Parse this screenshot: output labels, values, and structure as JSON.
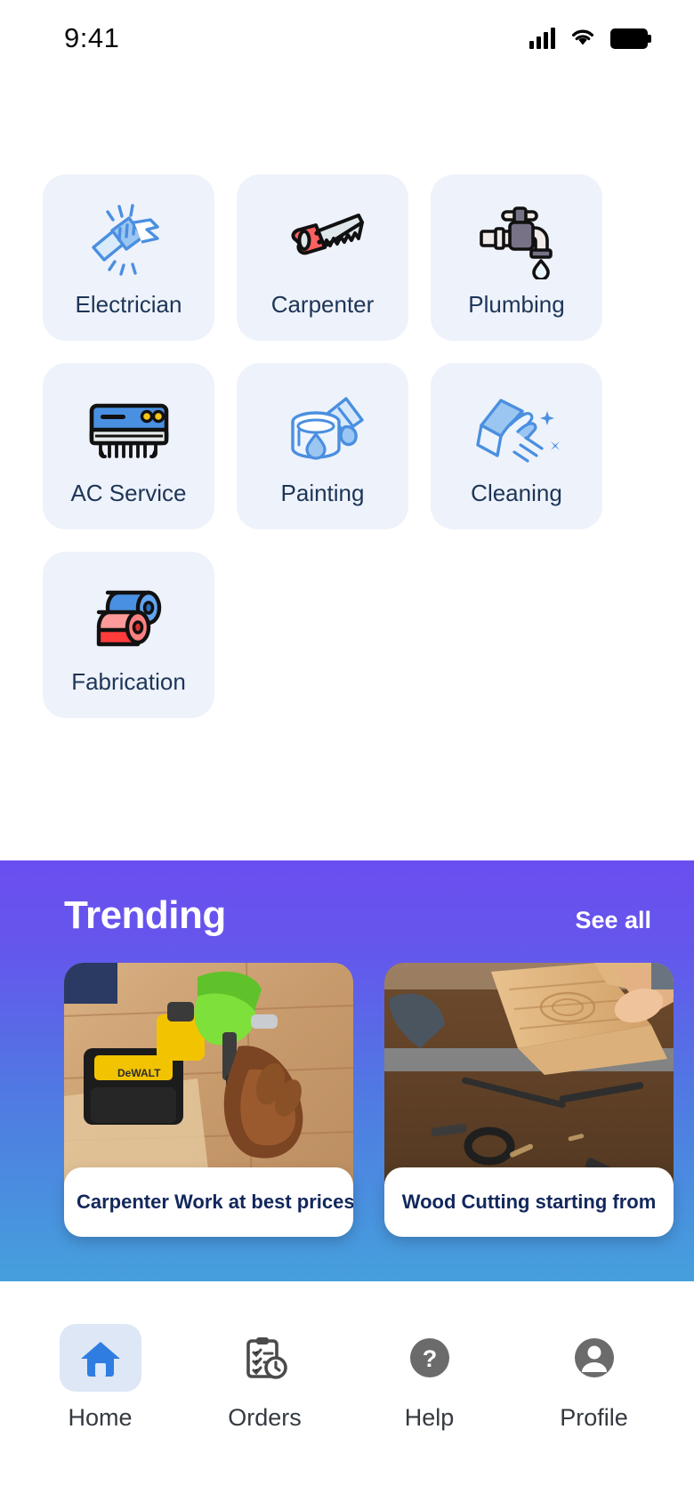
{
  "status_bar": {
    "time": "9:41",
    "signal_icon": "cellular-signal-icon",
    "wifi_icon": "wifi-icon",
    "battery_icon": "battery-full-icon"
  },
  "services": {
    "card_bg": "#EEF2FA",
    "label_color": "#1d3557",
    "items": [
      {
        "label": "Electrician",
        "icon": "electric-plug-icon"
      },
      {
        "label": "Carpenter",
        "icon": "hand-saw-icon"
      },
      {
        "label": "Plumbing",
        "icon": "faucet-tap-icon"
      },
      {
        "label": "AC Service",
        "icon": "air-conditioner-icon"
      },
      {
        "label": "Painting",
        "icon": "paint-bucket-brush-icon"
      },
      {
        "label": "Cleaning",
        "icon": "cleaning-wipe-icon"
      },
      {
        "label": "Fabrication",
        "icon": "fabric-rolls-icon"
      }
    ]
  },
  "trending": {
    "title": "Trending",
    "see_all_label": "See all",
    "gradient_start": "#6B4EF0",
    "gradient_end": "#45A0DC",
    "cards": [
      {
        "caption": "Carpenter Work at best prices",
        "image": "drill-on-wood-floor-photo"
      },
      {
        "caption": "Wood Cutting starting from",
        "image": "cutting-wood-planks-photo"
      }
    ]
  },
  "bottom_nav": {
    "active_index": 0,
    "active_pill_color": "#DDE7F5",
    "items": [
      {
        "label": "Home",
        "icon": "home-icon"
      },
      {
        "label": "Orders",
        "icon": "clipboard-clock-icon"
      },
      {
        "label": "Help",
        "icon": "question-circle-icon"
      },
      {
        "label": "Profile",
        "icon": "person-circle-icon"
      }
    ]
  }
}
